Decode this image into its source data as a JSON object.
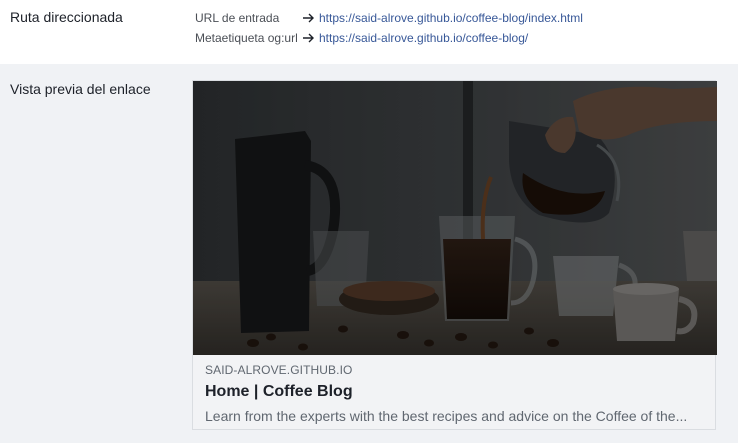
{
  "redirect_section": {
    "label": "Ruta direccionada",
    "rows": [
      {
        "key": "URL de entrada",
        "url": "https://said-alrove.github.io/coffee-blog/index.html"
      },
      {
        "key": "Metaetiqueta og:url",
        "url": "https://said-alrove.github.io/coffee-blog/"
      }
    ]
  },
  "preview_section": {
    "label": "Vista previa del enlace",
    "card": {
      "domain": "SAID-ALROVE.GITHUB.IO",
      "title": "Home | Coffee Blog",
      "description": "Learn from the experts with the best recipes and advice on the Coffee of the..."
    }
  },
  "colors": {
    "link": "#385898",
    "muted_text": "#606770",
    "section_bg": "#f0f2f5",
    "card_bg": "#f2f3f5"
  },
  "icons": [
    "arrow-right-icon"
  ]
}
